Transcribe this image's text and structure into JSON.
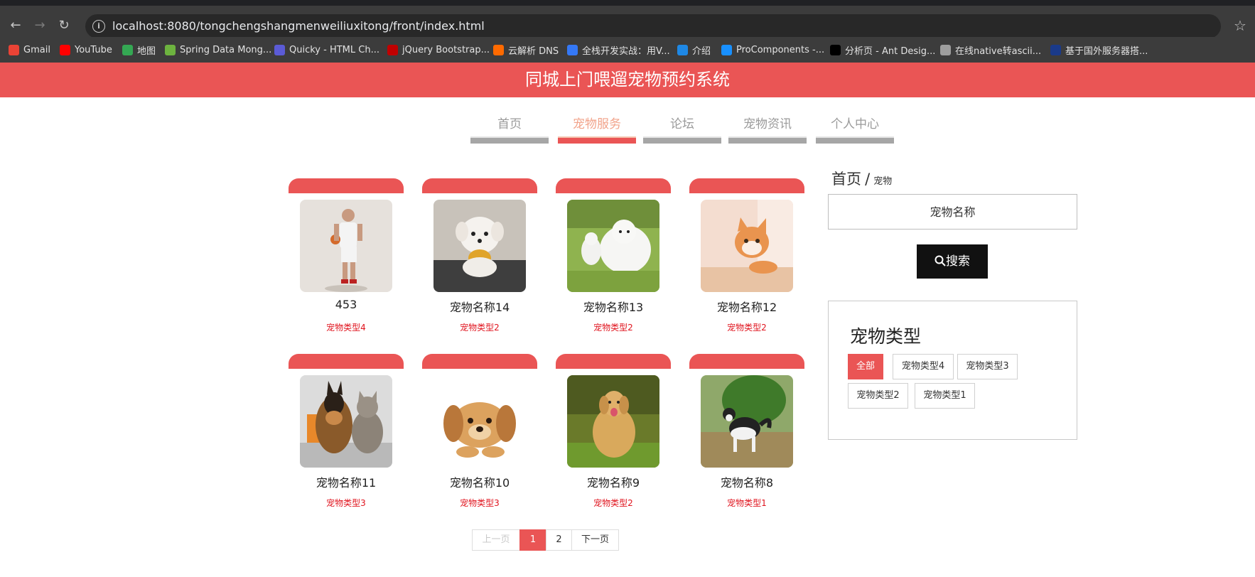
{
  "browser": {
    "url": "localhost:8080/tongchengshangmenweiliuxitong/front/index.html",
    "bookmarks": [
      {
        "label": "Gmail",
        "icon": "gmail-icon",
        "color": "#ea4335"
      },
      {
        "label": "YouTube",
        "icon": "youtube-icon",
        "color": "#ff0000"
      },
      {
        "label": "地图",
        "icon": "maps-icon",
        "color": "#34a853"
      },
      {
        "label": "Spring Data Mong...",
        "icon": "spring-icon",
        "color": "#6db33f"
      },
      {
        "label": "Quicky - HTML Ch...",
        "icon": "quicky-icon",
        "color": "#5b5bd6"
      },
      {
        "label": "jQuery Bootstrap...",
        "icon": "jquery-icon",
        "color": "#c00000"
      },
      {
        "label": "云解析 DNS",
        "icon": "aliyun-icon",
        "color": "#ff6a00"
      },
      {
        "label": "全栈开发实战：用V...",
        "icon": "m-icon",
        "color": "#3478f6"
      },
      {
        "label": "介绍",
        "icon": "globe-blue-icon",
        "color": "#1e88e5"
      },
      {
        "label": "ProComponents -...",
        "icon": "procomponents-icon",
        "color": "#1890ff"
      },
      {
        "label": "分析页 - Ant Desig...",
        "icon": "pro-icon",
        "color": "#000000"
      },
      {
        "label": "在线native转ascii...",
        "icon": "globe-icon",
        "color": "#9e9e9e"
      },
      {
        "label": "基于国外服务器搭...",
        "icon": "flag-icon",
        "color": "#1a3a8a"
      }
    ]
  },
  "site": {
    "title": "同城上门喂遛宠物预约系统",
    "nav": [
      {
        "label": "首页",
        "active": false
      },
      {
        "label": "宠物服务",
        "active": true
      },
      {
        "label": "论坛",
        "active": false
      },
      {
        "label": "宠物资讯",
        "active": false
      },
      {
        "label": "个人中心",
        "active": false
      }
    ]
  },
  "pets": [
    {
      "name": "453",
      "type": "宠物类型4",
      "image": "person-basketball"
    },
    {
      "name": "宠物名称14",
      "type": "宠物类型2",
      "image": "white-puppy"
    },
    {
      "name": "宠物名称13",
      "type": "宠物类型2",
      "image": "samoyed"
    },
    {
      "name": "宠物名称12",
      "type": "宠物类型2",
      "image": "orange-kitten"
    },
    {
      "name": "宠物名称11",
      "type": "宠物类型3",
      "image": "dog-and-cat"
    },
    {
      "name": "宠物名称10",
      "type": "宠物类型3",
      "image": "puppy"
    },
    {
      "name": "宠物名称9",
      "type": "宠物类型2",
      "image": "golden-retriever"
    },
    {
      "name": "宠物名称8",
      "type": "宠物类型1",
      "image": "husky"
    }
  ],
  "pagination": {
    "prev": "上一页",
    "pages": [
      "1",
      "2"
    ],
    "current": "1",
    "next": "下一页"
  },
  "sidebar": {
    "breadcrumb_home": "首页",
    "breadcrumb_sep": "/",
    "breadcrumb_current": "宠物",
    "search_placeholder": "宠物名称",
    "search_button": "搜索",
    "type_title": "宠物类型",
    "types": [
      "全部",
      "宠物类型4",
      "宠物类型3",
      "宠物类型2",
      "宠物类型1"
    ],
    "active_type": "全部"
  },
  "colors": {
    "accent": "#ea5555",
    "type_text": "#e0141e"
  }
}
